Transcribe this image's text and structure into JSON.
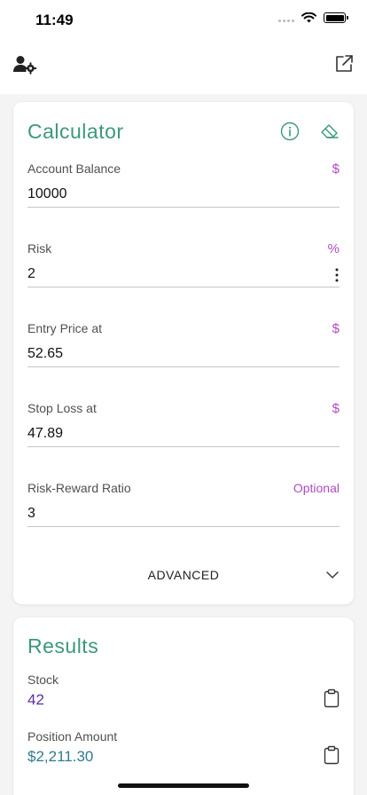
{
  "status_bar": {
    "time": "11:49"
  },
  "top_bar": {
    "left_icon": "user-settings-icon",
    "right_icon": "share-icon"
  },
  "calculator": {
    "title": "Calculator",
    "fields": [
      {
        "label": "Account Balance",
        "unit": "$",
        "value": "10000"
      },
      {
        "label": "Risk",
        "unit": "%",
        "value": "2"
      },
      {
        "label": "Entry Price at",
        "unit": "$",
        "value": "52.65"
      },
      {
        "label": "Stop Loss at",
        "unit": "$",
        "value": "47.89"
      },
      {
        "label": "Risk-Reward Ratio",
        "unit": "Optional",
        "value": "3"
      }
    ],
    "advanced_label": "ADVANCED"
  },
  "results": {
    "title": "Results",
    "items": [
      {
        "label": "Stock",
        "value": "42"
      },
      {
        "label": "Position Amount",
        "value": "$2,211.30"
      }
    ]
  },
  "colors": {
    "accent_green": "#3a9a78",
    "unit_purple": "#b04ac0",
    "stock_value": "#5a2ea6",
    "amount_value": "#2f7a92"
  }
}
